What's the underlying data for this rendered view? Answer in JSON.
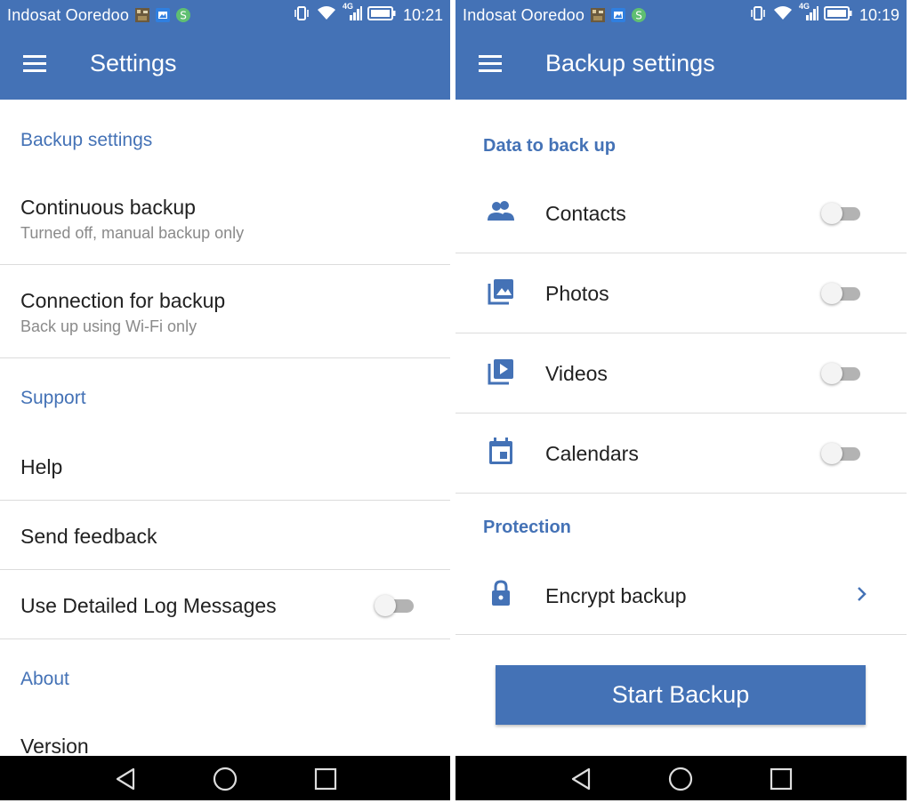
{
  "colors": {
    "accent": "#4472b6",
    "divider": "#dcdcdc",
    "subtitle": "#8a8a8a",
    "navbar": "#000000"
  },
  "left": {
    "status": {
      "carrier": "Indosat Ooredoo",
      "network": "4G",
      "time": "10:21"
    },
    "appbar": {
      "title": "Settings",
      "menu_icon": "hamburger-menu-icon"
    },
    "sections": {
      "backup": "Backup settings",
      "support": "Support",
      "about": "About"
    },
    "items": {
      "continuous_backup": {
        "title": "Continuous backup",
        "subtitle": "Turned off, manual backup only"
      },
      "connection_backup": {
        "title": "Connection for backup",
        "subtitle": "Back up using Wi-Fi only"
      },
      "help": {
        "title": "Help"
      },
      "send_feedback": {
        "title": "Send feedback"
      },
      "detailed_log": {
        "title": "Use Detailed Log Messages",
        "enabled": false
      },
      "version": {
        "title": "Version"
      }
    }
  },
  "right": {
    "status": {
      "carrier": "Indosat Ooredoo",
      "network": "4G",
      "time": "10:19"
    },
    "appbar": {
      "title": "Backup settings",
      "menu_icon": "hamburger-menu-icon"
    },
    "sections": {
      "data": "Data to back up",
      "protection": "Protection"
    },
    "items": {
      "contacts": {
        "label": "Contacts",
        "icon": "contacts-icon",
        "enabled": false
      },
      "photos": {
        "label": "Photos",
        "icon": "photos-icon",
        "enabled": false
      },
      "videos": {
        "label": "Videos",
        "icon": "videos-icon",
        "enabled": false
      },
      "calendars": {
        "label": "Calendars",
        "icon": "calendar-icon",
        "enabled": false
      },
      "encrypt": {
        "label": "Encrypt backup",
        "icon": "lock-icon"
      }
    },
    "button": {
      "label": "Start Backup"
    }
  },
  "navbar": {
    "icons": [
      "back-icon",
      "home-icon",
      "recents-icon"
    ]
  }
}
